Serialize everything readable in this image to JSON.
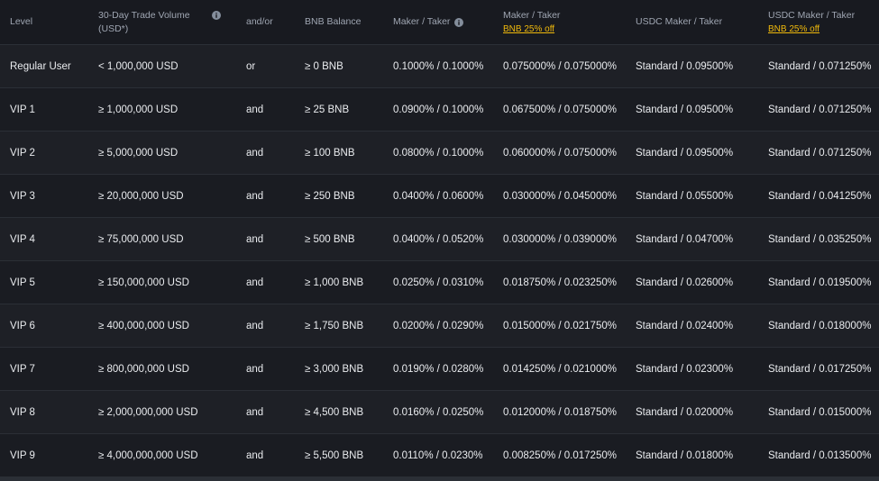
{
  "headers": {
    "level": "Level",
    "volume_line1": "30-Day Trade Volume",
    "volume_line2": "(USD*)",
    "and_or": "and/or",
    "bnb_balance": "BNB Balance",
    "maker_taker": "Maker / Taker",
    "maker_taker_bnb": "Maker / Taker",
    "bnb_discount": "BNB 25% off",
    "usdc_maker_taker": "USDC Maker / Taker",
    "usdc_maker_taker_bnb": "USDC Maker / Taker",
    "usdc_bnb_discount": "BNB 25% off"
  },
  "rows": [
    {
      "level": "Regular User",
      "volume": "< 1,000,000 USD",
      "andor": "or",
      "bnb": "≥ 0 BNB",
      "mt": "0.1000% / 0.1000%",
      "mt_bnb": "0.075000% / 0.075000%",
      "usdc": "Standard / 0.09500%",
      "usdc_bnb": "Standard / 0.071250%"
    },
    {
      "level": "VIP 1",
      "volume": "≥ 1,000,000 USD",
      "andor": "and",
      "bnb": "≥ 25 BNB",
      "mt": "0.0900% / 0.1000%",
      "mt_bnb": "0.067500% / 0.075000%",
      "usdc": "Standard / 0.09500%",
      "usdc_bnb": "Standard / 0.071250%"
    },
    {
      "level": "VIP 2",
      "volume": "≥ 5,000,000 USD",
      "andor": "and",
      "bnb": "≥ 100 BNB",
      "mt": "0.0800% / 0.1000%",
      "mt_bnb": "0.060000% / 0.075000%",
      "usdc": "Standard / 0.09500%",
      "usdc_bnb": "Standard / 0.071250%"
    },
    {
      "level": "VIP 3",
      "volume": "≥ 20,000,000 USD",
      "andor": "and",
      "bnb": "≥ 250 BNB",
      "mt": "0.0400% / 0.0600%",
      "mt_bnb": "0.030000% / 0.045000%",
      "usdc": "Standard / 0.05500%",
      "usdc_bnb": "Standard / 0.041250%"
    },
    {
      "level": "VIP 4",
      "volume": "≥ 75,000,000 USD",
      "andor": "and",
      "bnb": "≥ 500 BNB",
      "mt": "0.0400% / 0.0520%",
      "mt_bnb": "0.030000% / 0.039000%",
      "usdc": "Standard / 0.04700%",
      "usdc_bnb": "Standard / 0.035250%"
    },
    {
      "level": "VIP 5",
      "volume": "≥ 150,000,000 USD",
      "andor": "and",
      "bnb": "≥ 1,000 BNB",
      "mt": "0.0250% / 0.0310%",
      "mt_bnb": "0.018750% / 0.023250%",
      "usdc": "Standard / 0.02600%",
      "usdc_bnb": "Standard / 0.019500%"
    },
    {
      "level": "VIP 6",
      "volume": "≥ 400,000,000 USD",
      "andor": "and",
      "bnb": "≥ 1,750 BNB",
      "mt": "0.0200% / 0.0290%",
      "mt_bnb": "0.015000% / 0.021750%",
      "usdc": "Standard / 0.02400%",
      "usdc_bnb": "Standard / 0.018000%"
    },
    {
      "level": "VIP 7",
      "volume": "≥ 800,000,000 USD",
      "andor": "and",
      "bnb": "≥ 3,000 BNB",
      "mt": "0.0190% / 0.0280%",
      "mt_bnb": "0.014250% / 0.021000%",
      "usdc": "Standard / 0.02300%",
      "usdc_bnb": "Standard / 0.017250%"
    },
    {
      "level": "VIP 8",
      "volume": "≥ 2,000,000,000 USD",
      "andor": "and",
      "bnb": "≥ 4,500 BNB",
      "mt": "0.0160% / 0.0250%",
      "mt_bnb": "0.012000% / 0.018750%",
      "usdc": "Standard / 0.02000%",
      "usdc_bnb": "Standard / 0.015000%"
    },
    {
      "level": "VIP 9",
      "volume": "≥ 4,000,000,000 USD",
      "andor": "and",
      "bnb": "≥ 5,500 BNB",
      "mt": "0.0110% / 0.0230%",
      "mt_bnb": "0.008250% / 0.017250%",
      "usdc": "Standard / 0.01800%",
      "usdc_bnb": "Standard / 0.013500%"
    }
  ],
  "colors": {
    "background": "#181a20",
    "row_alt": "#1e2026",
    "border": "#2b2f36",
    "header_text": "#9fa6b2",
    "body_text": "#eaecef",
    "promo_accent": "#f0b90b"
  },
  "icons": {
    "volume_info": "info-icon",
    "maker_taker_info": "info-icon"
  }
}
